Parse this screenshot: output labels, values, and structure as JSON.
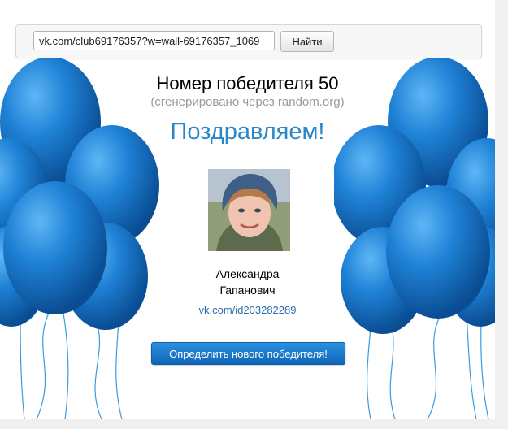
{
  "search": {
    "url_value": "vk.com/club69176357?w=wall-69176357_1069",
    "find_label": "Найти"
  },
  "result": {
    "title": "Номер победителя 50",
    "subtitle": "(сгенерировано через random.org)",
    "congrats": "Поздравляем!",
    "first_name": "Александра",
    "last_name": "Гапанович",
    "profile_link": "vk.com/id203282289",
    "new_winner_label": "Определить нового победителя!"
  },
  "colors": {
    "accent": "#2b87c7",
    "balloon": "#1f7fd0",
    "button": "#1673c4",
    "link": "#2b6db0"
  },
  "icons": {
    "decor": "balloon-cluster-icon"
  }
}
